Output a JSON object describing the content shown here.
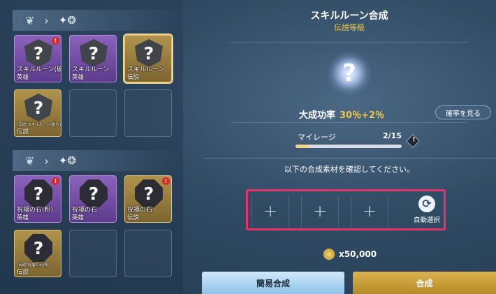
{
  "left": {
    "sections": [
      {
        "items": [
          {
            "name": "スキルルーン(破片)",
            "rarity": "英雄",
            "tier": "hero",
            "shape": "shield",
            "alert": true,
            "tiny": false,
            "selected": false
          },
          {
            "name": "スキルルーン",
            "rarity": "英雄",
            "tier": "hero",
            "shape": "shield",
            "alert": false,
            "tiny": false,
            "selected": false
          },
          {
            "name": "スキルルーン",
            "rarity": "伝説",
            "tier": "legend",
            "shape": "shield",
            "alert": false,
            "tiny": false,
            "selected": true
          },
          {
            "name": "[伝説]スキルルーン(破片)",
            "rarity": "伝説",
            "tier": "legend",
            "shape": "shield",
            "alert": false,
            "tiny": true,
            "selected": false
          }
        ],
        "empty_slots": 2
      },
      {
        "items": [
          {
            "name": "祝福の石(粉)",
            "rarity": "英雄",
            "tier": "hero",
            "shape": "oct",
            "alert": true,
            "tiny": false,
            "selected": false
          },
          {
            "name": "祝福の石",
            "rarity": "英雄",
            "tier": "hero",
            "shape": "oct",
            "alert": false,
            "tiny": false,
            "selected": false
          },
          {
            "name": "祝福の石",
            "rarity": "伝説",
            "tier": "legend",
            "shape": "oct",
            "alert": true,
            "tiny": false,
            "selected": false
          },
          {
            "name": "[伝説]祝福の石(粉)",
            "rarity": "伝説",
            "tier": "legend",
            "shape": "oct",
            "alert": false,
            "tiny": true,
            "selected": false
          }
        ],
        "empty_slots": 2
      }
    ]
  },
  "synthesis": {
    "title": "スキルルーン合成",
    "grade": "伝説等級",
    "result_icon": "question-mark",
    "success_label": "大成功率",
    "success_value": "30％+2％",
    "rate_button": "確率を見る",
    "mileage_label": "マイレージ",
    "mileage_value": "2/15",
    "mileage_fraction": 0.133,
    "confirm_text": "以下の合成素材を確認してください。",
    "slot_glyph": "+",
    "auto_label": "自動選択",
    "cost": "x50,000",
    "easy_button": "簡易合成",
    "synth_button": "合成"
  }
}
